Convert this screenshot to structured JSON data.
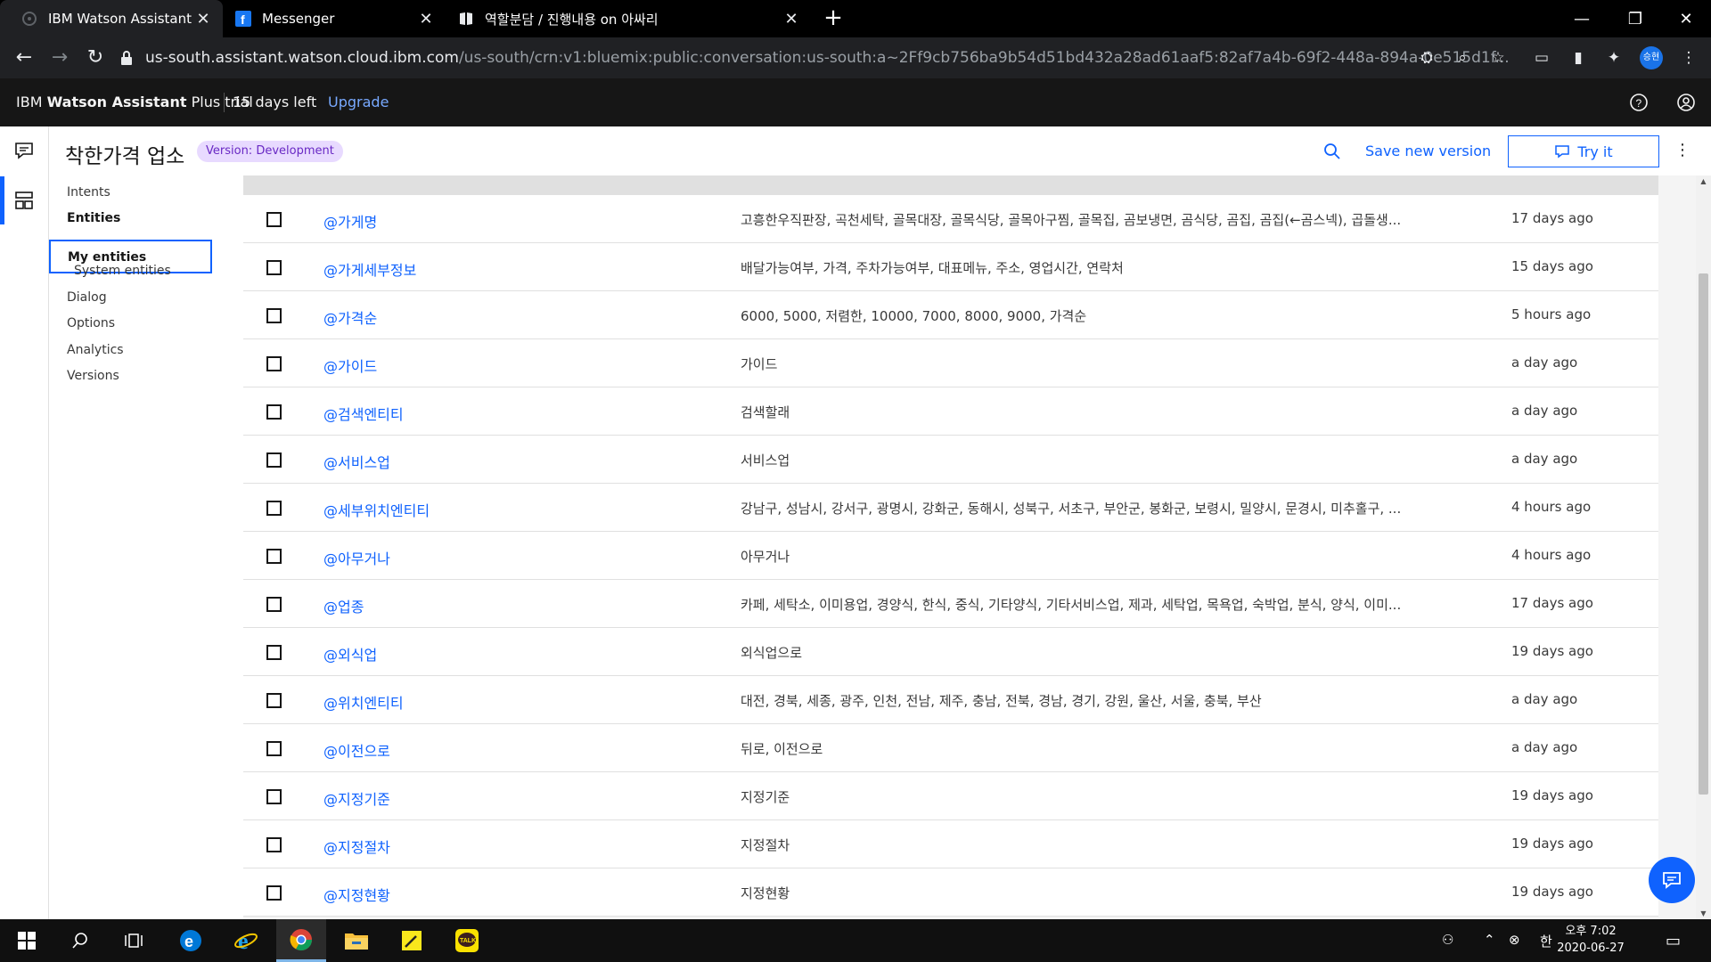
{
  "browser": {
    "tabs": [
      {
        "title": "IBM Watson Assistant",
        "active": true,
        "icon": "ibm-favicon"
      },
      {
        "title": "Messenger",
        "active": false,
        "icon": "facebook-favicon"
      },
      {
        "title": "역할분담 / 진행내용 on 아싸리",
        "active": false,
        "icon": "notion-favicon"
      }
    ],
    "url_domain": "us-south.assistant.watson.cloud.ibm.com",
    "url_path": "/us-south/crn:v1:bluemix:public:conversation:us-south:a~2Ff9cb756ba9b54d51bd432a28ad61aaf5:82af7a4b-69f2-448a-894a-0e515d1f...",
    "profile_initials": "승현"
  },
  "header": {
    "brand_prefix": "IBM ",
    "brand_bold": "Watson Assistant",
    "brand_suffix": " Plus trial",
    "trial_days": "15 days left",
    "upgrade": "Upgrade"
  },
  "titlebar": {
    "skill_name": "착한가격 업소",
    "version_badge": "Version: Development",
    "save_version": "Save new version",
    "try_it": "Try it"
  },
  "nav": {
    "intents": "Intents",
    "entities": "Entities",
    "my_entities": "My entities",
    "system_entities": "System entities",
    "dialog": "Dialog",
    "options": "Options",
    "analytics": "Analytics",
    "versions": "Versions"
  },
  "entities": [
    {
      "name": "@가게명",
      "values": "고흥한우직판장, 곡천세탁, 골목대장, 골목식당, 골목아구찜, 골목집, 곰보냉면, 곰식당, 곰집, 곰집(←곰스넥), 곱돌생...",
      "modified": "17 days ago"
    },
    {
      "name": "@가게세부정보",
      "values": "배달가능여부, 가격, 주차가능여부, 대표메뉴, 주소, 영업시간, 연락처",
      "modified": "15 days ago"
    },
    {
      "name": "@가격순",
      "values": "6000, 5000, 저렴한, 10000, 7000, 8000, 9000, 가격순",
      "modified": "5 hours ago"
    },
    {
      "name": "@가이드",
      "values": "가이드",
      "modified": "a day ago"
    },
    {
      "name": "@검색엔티티",
      "values": "검색할래",
      "modified": "a day ago"
    },
    {
      "name": "@서비스업",
      "values": "서비스업",
      "modified": "a day ago"
    },
    {
      "name": "@세부위치엔티티",
      "values": "강남구, 성남시, 강서구, 광명시, 강화군, 동해시, 성북구, 서초구, 부안군, 봉화군, 보령시, 밀양시, 문경시, 미추홀구, ...",
      "modified": "4 hours ago"
    },
    {
      "name": "@아무거나",
      "values": "아무거나",
      "modified": "4 hours ago"
    },
    {
      "name": "@업종",
      "values": "카페, 세탁소, 이미용업, 경양식, 한식, 중식, 기타양식, 기타서비스업, 제과, 세탁업, 목욕업, 숙박업, 분식, 양식, 이미...",
      "modified": "17 days ago"
    },
    {
      "name": "@외식업",
      "values": "외식업으로",
      "modified": "19 days ago"
    },
    {
      "name": "@위치엔티티",
      "values": "대전, 경북, 세종, 광주, 인천, 전남, 제주, 충남, 전북, 경남, 경기, 강원, 울산, 서울, 충북, 부산",
      "modified": "a day ago"
    },
    {
      "name": "@이전으로",
      "values": "뒤로, 이전으로",
      "modified": "a day ago"
    },
    {
      "name": "@지정기준",
      "values": "지정기준",
      "modified": "19 days ago"
    },
    {
      "name": "@지정절차",
      "values": "지정절차",
      "modified": "19 days ago"
    },
    {
      "name": "@지정현황",
      "values": "지정현황",
      "modified": "19 days ago"
    }
  ],
  "taskbar": {
    "clock_time": "오후 7:02",
    "clock_date": "2020-06-27",
    "ime": "한"
  },
  "colors": {
    "accent": "#0f62fe",
    "badge_bg": "#e8daff",
    "badge_text": "#6929c4"
  }
}
